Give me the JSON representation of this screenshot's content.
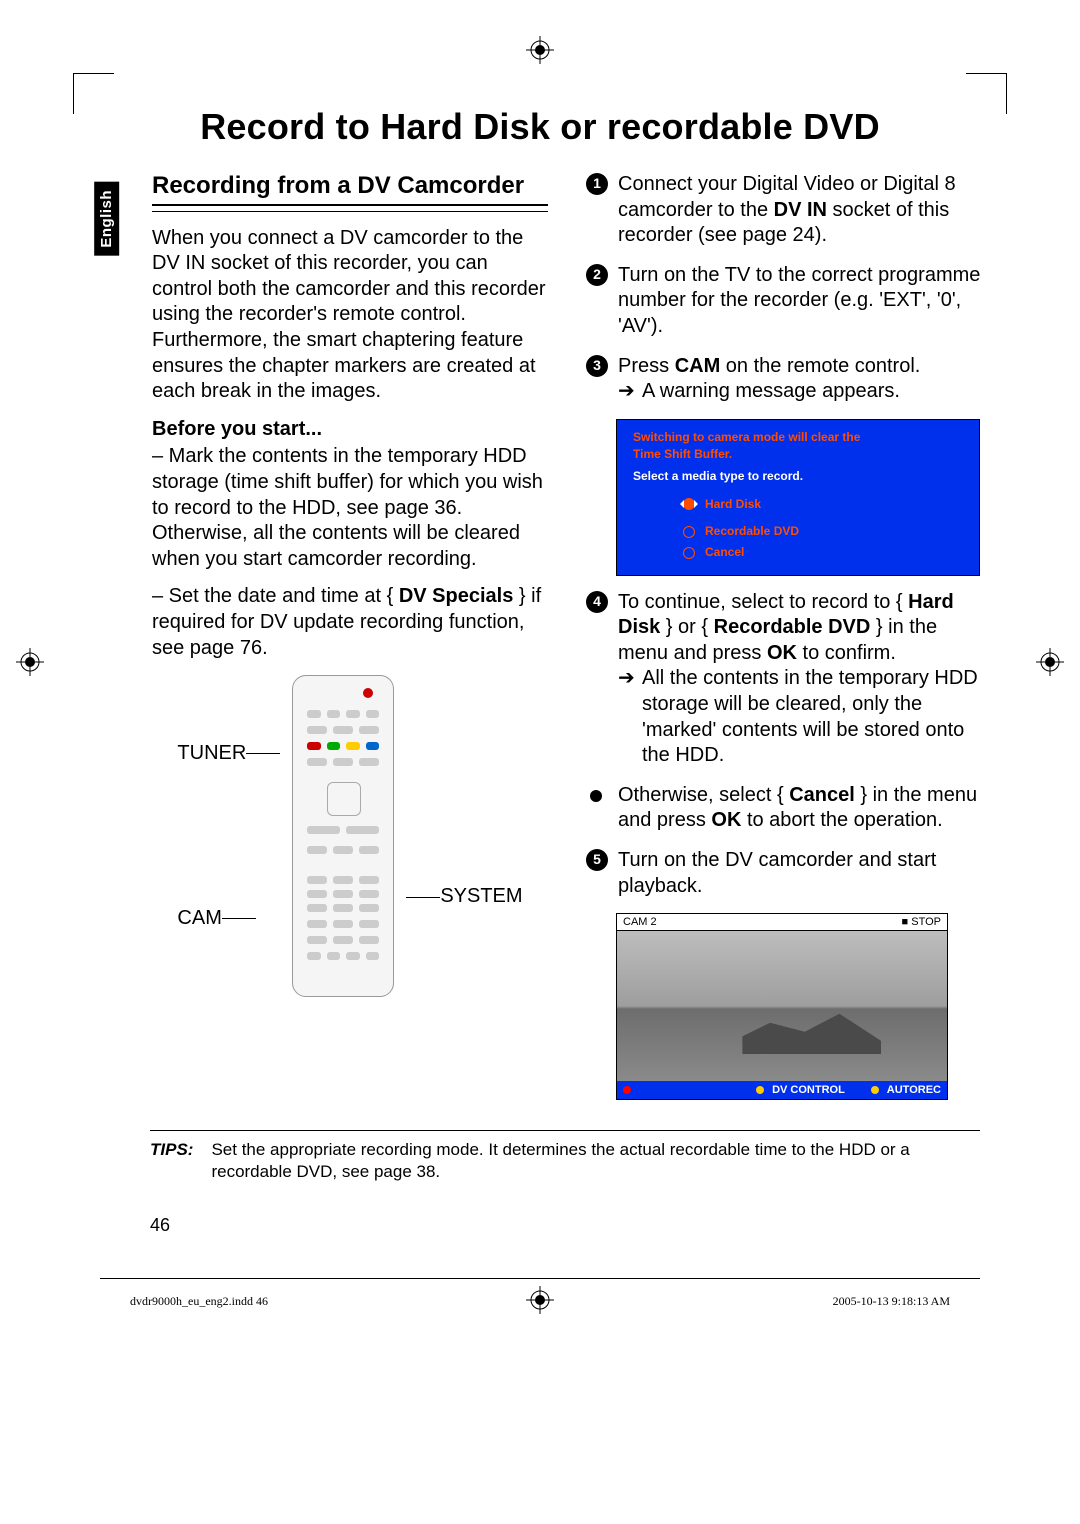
{
  "language_tab": "English",
  "page_title": "Record to Hard Disk or recordable DVD",
  "section_heading": "Recording from a DV Camcorder",
  "intro_para": "When you connect a DV camcorder to the DV IN socket of this recorder, you can control both the camcorder and this recorder using the recorder's remote control. Furthermore, the smart chaptering feature ensures the chapter markers are created at each break in the images.",
  "before_heading": "Before you start...",
  "before_item1": "– Mark the contents in the temporary HDD storage (time shift buffer) for which you wish to record to the HDD, see page 36. Otherwise, all the contents will be cleared when you start camcorder recording.",
  "before_item2_pre": "– Set the date and time at { ",
  "before_item2_bold": "DV Specials",
  "before_item2_post": " } if required for DV update recording function, see page 76.",
  "remote_labels": {
    "tuner": "TUNER",
    "system": "SYSTEM",
    "cam": "CAM"
  },
  "steps": {
    "s1_pre": "Connect your Digital Video or Digital 8 camcorder to the ",
    "s1_bold": "DV IN",
    "s1_post": " socket of this recorder (see page 24).",
    "s2": "Turn on the TV to the correct programme number for the recorder (e.g. 'EXT', '0', 'AV').",
    "s3_pre": "Press ",
    "s3_bold": "CAM",
    "s3_post": " on the remote control.",
    "s3_sub": "A warning message appears.",
    "s4_pre": "To continue, select to record to { ",
    "s4_b1": "Hard Disk",
    "s4_mid": " } or { ",
    "s4_b2": "Recordable DVD",
    "s4_mid2": " } in the menu and press ",
    "s4_b3": "OK",
    "s4_post": " to confirm.",
    "s4_sub": "All the contents in the temporary HDD storage will be cleared, only the 'marked' contents will be stored onto the HDD.",
    "sBullet_pre": "Otherwise, select { ",
    "sBullet_b1": "Cancel",
    "sBullet_mid": " } in the menu and press ",
    "sBullet_b2": "OK",
    "sBullet_post": " to abort the operation.",
    "s5": "Turn on the DV camcorder and start playback."
  },
  "dialog": {
    "line1": "Switching to camera mode will clear the",
    "line2": "Time Shift Buffer.",
    "subline": "Select a media type to record.",
    "opt1": "Hard Disk",
    "opt2": "Recordable DVD",
    "opt3": "Cancel"
  },
  "cam": {
    "top_left": "CAM 2",
    "top_right": "■ STOP",
    "bar_left": "DV CONTROL",
    "bar_right": "AUTOREC"
  },
  "tips_label": "TIPS:",
  "tips_text": "Set the appropriate recording mode. It determines the actual recordable time to the HDD or a recordable DVD, see page 38.",
  "page_number": "46",
  "footer_left": "dvdr9000h_eu_eng2.indd   46",
  "footer_right": "2005-10-13   9:18:13 AM"
}
